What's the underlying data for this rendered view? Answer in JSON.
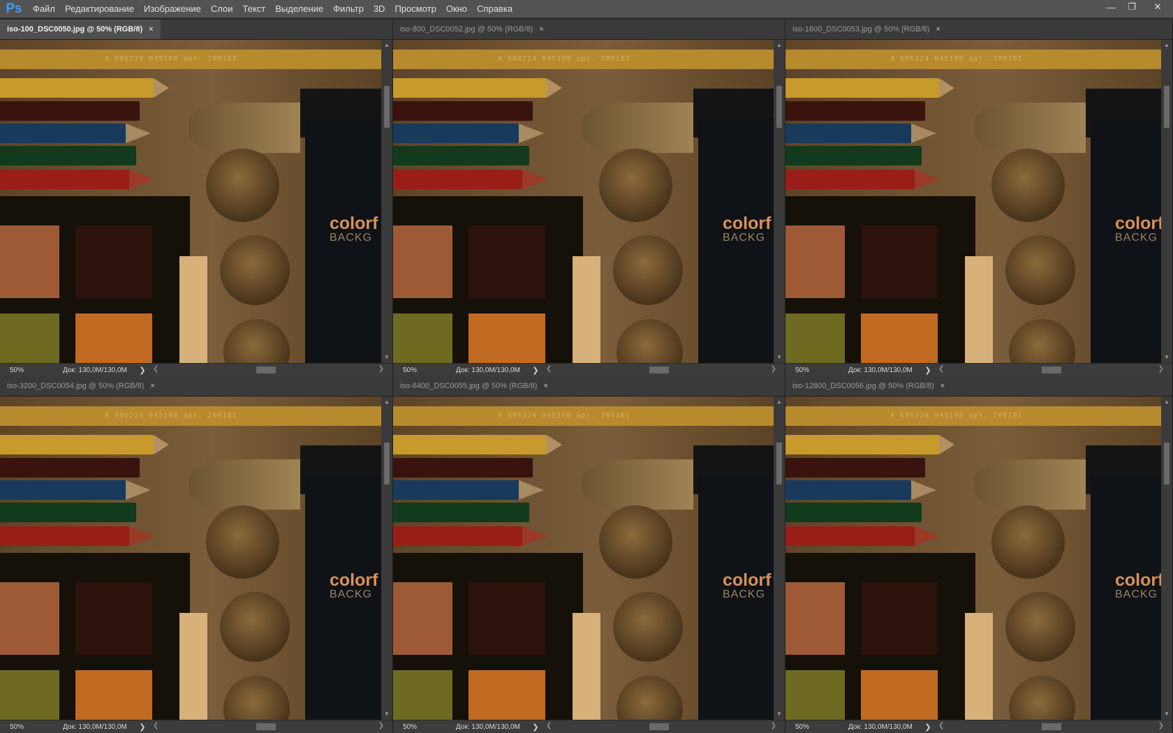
{
  "app": {
    "logo": "Ps"
  },
  "menu": [
    "Файл",
    "Редактирование",
    "Изображение",
    "Слои",
    "Текст",
    "Выделение",
    "Фильтр",
    "3D",
    "Просмотр",
    "Окно",
    "Справка"
  ],
  "window_buttons": {
    "minimize": "—",
    "restore": "❐",
    "close": "✕"
  },
  "documents": [
    {
      "tab": "iso-100_DSC0050.jpg @ 50% (RGB/8)",
      "zoom": "50%",
      "doc_size": "Док: 130,0M/130,0M",
      "active": true
    },
    {
      "tab": "iso-800_DSC0052.jpg @ 50% (RGB/8)",
      "zoom": "50%",
      "doc_size": "Док: 130,0M/130,0M",
      "active": false
    },
    {
      "tab": "iso-1600_DSC0053.jpg @ 50% (RGB/8)",
      "zoom": "50%",
      "doc_size": "Док: 130,0M/130,0M",
      "active": false
    },
    {
      "tab": "iso-3200_DSC0054.jpg @ 50% (RGB/8)",
      "zoom": "50%",
      "doc_size": "Док: 130,0M/130,0M",
      "active": false
    },
    {
      "tab": "iso-6400_DSC0055.jpg @ 50% (RGB/8)",
      "zoom": "50%",
      "doc_size": "Док: 130,0M/130,0M",
      "active": false
    },
    {
      "tab": "iso-12800_DSC0056.jpg @ 50% (RGB/8)",
      "zoom": "50%",
      "doc_size": "Док: 130,0M/130,0M",
      "active": false
    }
  ],
  "photo_text": {
    "barcode": "4 606224 045108 арт. 200181",
    "card_title": "colorf",
    "card_subtitle": "BACKG"
  },
  "tab_close_glyph": "×",
  "colors": {
    "menubar": "#535353",
    "workspace": "#282828",
    "accent": "#3aa0ff"
  }
}
